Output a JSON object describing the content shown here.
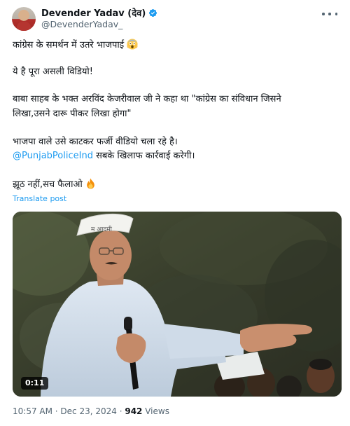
{
  "author": {
    "display_name": "Devender Yadav (देव)",
    "handle": "@DevenderYadav_",
    "avatar_icon": "profile-avatar",
    "verified_icon": "verified-badge-icon"
  },
  "tweet": {
    "line1": "कांग्रेस के समर्थन में उतरे भाजपाई",
    "line1_emoji": "face-screaming-in-fear",
    "line2": "ये है पूरा असली विडियो!",
    "line3": "बाबा साहब के भक्त अरविंद केजरीवाल जी ने कहा था \"कांग्रेस का संविधान जिसने",
    "line4": "लिखा,उसने दारू पीकर लिखा होगा\"",
    "line5": "भाजपा वाले उसे काटकर फर्जी वीडियो चला रहे है।",
    "mention": "@PunjabPoliceInd",
    "line6_rest": " सबके खिलाफ कार्रवाई करेगी।",
    "line7": "झूठ नहीं,सच फैलाओ",
    "line7_emoji": "fire",
    "translate_label": "Translate post"
  },
  "video": {
    "duration": "0:11",
    "cap_text": "म आदमी"
  },
  "meta": {
    "time": "10:57 AM",
    "separator": " · ",
    "date": "Dec 23, 2024",
    "views_count": "942",
    "views_label": " Views"
  },
  "colors": {
    "link": "#1d9bf0",
    "secondary_text": "#536471",
    "primary_text": "#0f1419"
  }
}
